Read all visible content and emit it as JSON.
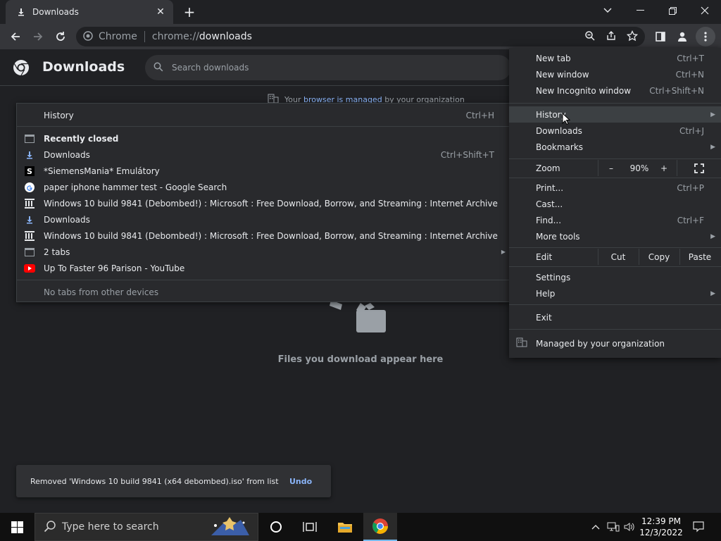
{
  "browser": {
    "tab_title": "Downloads",
    "site_label": "Chrome",
    "url_prefix": "chrome://",
    "url_path": "downloads"
  },
  "page": {
    "title": "Downloads",
    "search_placeholder": "Search downloads",
    "managed_prefix": "Your",
    "managed_link": "browser is managed",
    "managed_suffix": "by your organization",
    "empty_text": "Files you download appear here"
  },
  "history_menu": {
    "header": "History",
    "header_shortcut": "Ctrl+H",
    "recently_closed": "Recently closed",
    "items": [
      {
        "label": "Downloads",
        "shortcut": "Ctrl+Shift+T",
        "icon": "download-icon"
      },
      {
        "label": "*SiemensMania* Emulátory",
        "icon": "siemensmania-favicon"
      },
      {
        "label": "paper iphone hammer test - Google Search",
        "icon": "google-favicon"
      },
      {
        "label": "Windows 10 build 9841 (Debombed!) : Microsoft : Free Download, Borrow, and Streaming : Internet Archive",
        "icon": "archive-favicon"
      },
      {
        "label": "Downloads",
        "icon": "download-icon"
      },
      {
        "label": "Windows 10 build 9841 (Debombed!) : Microsoft : Free Download, Borrow, and Streaming : Internet Archive",
        "icon": "archive-favicon"
      },
      {
        "label": "2 tabs",
        "icon": "window-icon"
      },
      {
        "label": "Up To Faster 96 Parison - YouTube",
        "icon": "youtube-favicon"
      }
    ],
    "no_devices": "No tabs from other devices"
  },
  "main_menu": {
    "new_tab": "New tab",
    "new_tab_sc": "Ctrl+T",
    "new_window": "New window",
    "new_window_sc": "Ctrl+N",
    "incognito": "New Incognito window",
    "incognito_sc": "Ctrl+Shift+N",
    "history": "History",
    "downloads": "Downloads",
    "downloads_sc": "Ctrl+J",
    "bookmarks": "Bookmarks",
    "zoom": "Zoom",
    "zoom_minus": "–",
    "zoom_value": "90%",
    "zoom_plus": "+",
    "print": "Print...",
    "print_sc": "Ctrl+P",
    "cast": "Cast...",
    "find": "Find...",
    "find_sc": "Ctrl+F",
    "more_tools": "More tools",
    "edit": "Edit",
    "cut": "Cut",
    "copy": "Copy",
    "paste": "Paste",
    "settings": "Settings",
    "help": "Help",
    "exit": "Exit",
    "managed": "Managed by your organization"
  },
  "snackbar": {
    "message": "Removed 'Windows 10 build 9841 (x64 debombed).iso' from list",
    "undo": "Undo"
  },
  "taskbar": {
    "search_placeholder": "Type here to search",
    "time": "12:39 PM",
    "date": "12/3/2022"
  },
  "colors": {
    "accent_link": "#8ab4f8",
    "menu_bg": "#292a2d",
    "page_bg": "#202124"
  }
}
